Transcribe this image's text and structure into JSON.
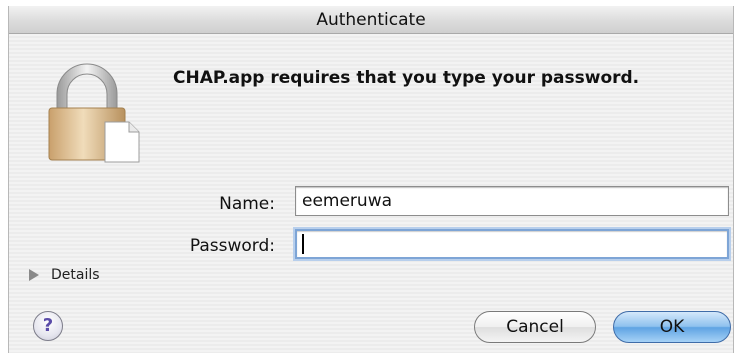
{
  "window": {
    "title": "Authenticate"
  },
  "dialog": {
    "message": "CHAP.app requires that you type your password.",
    "name_label": "Name:",
    "name_value": "eemeruwa",
    "password_label": "Password:",
    "password_value": "",
    "details_label": "Details",
    "help_label": "?",
    "cancel_label": "Cancel",
    "ok_label": "OK"
  },
  "icons": {
    "lock": "padlock-document-icon",
    "details": "disclosure-triangle-icon",
    "help": "help-icon"
  },
  "colors": {
    "focus_ring": "#7ea5d6",
    "default_button": "#5fa3e3",
    "lock_body": "#d9b98a"
  }
}
